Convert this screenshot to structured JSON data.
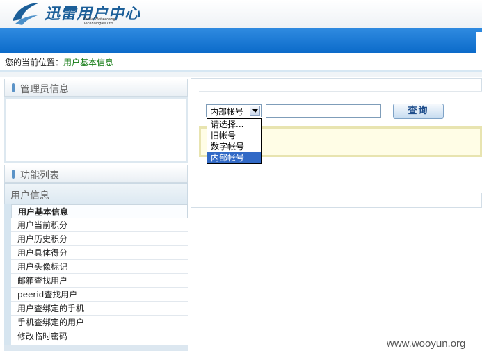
{
  "header": {
    "logo_text": "迅雷用户中心",
    "logo_sub": "Xunlei Networking Technologies,Ltd",
    "brand_color": "#1c5f99",
    "bar_color": "#0b6ac9"
  },
  "breadcrumb": {
    "label": "您的当前位置：",
    "current": "用户基本信息"
  },
  "sidebar": {
    "admin_title": "管理员信息",
    "function_title": "功能列表",
    "group_title": "用户信息",
    "items": [
      {
        "label": "用户基本信息",
        "active": true
      },
      {
        "label": "用户当前积分"
      },
      {
        "label": "用户历史积分"
      },
      {
        "label": "用户具体得分"
      },
      {
        "label": "用户头像标记"
      },
      {
        "label": "邮箱查找用户"
      },
      {
        "label": "peerid查找用户"
      },
      {
        "label": "用户查绑定的手机"
      },
      {
        "label": "手机查绑定的用户"
      },
      {
        "label": "修改临时密码"
      }
    ]
  },
  "search": {
    "select_value": "内部帐号",
    "options": [
      "请选择...",
      "旧帐号",
      "数字帐号",
      "内部帐号"
    ],
    "selected_index": 3,
    "input_value": "",
    "button_label": "查询"
  },
  "watermark": "www.wooyun.org"
}
